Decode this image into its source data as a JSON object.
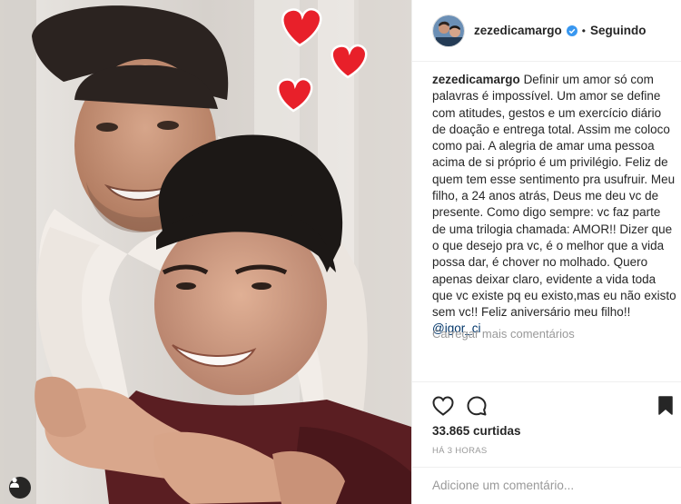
{
  "post": {
    "username": "zezedicamargo",
    "follow_label": "Seguindo",
    "separator": "•",
    "caption": "Definir um amor só com palavras é impossível. Um amor se define com atitudes, gestos e um exercício diário de doação e entrega total. Assim me coloco como pai. A alegria de amar uma pessoa acima de si próprio é um privilégio. Feliz de quem tem esse sentimento pra usufruir. Meu filho, a 24 anos atrás, Deus me deu vc de presente. Como digo sempre: vc faz parte de uma trilogia chamada: AMOR!! Dizer que o que desejo pra vc, é o melhor que a vida possa dar, é chover no molhado. Quero apenas deixar claro, evidente a vida toda que vc existe pq eu existo,mas eu não existo sem vc!! Feliz aniversário meu filho!!",
    "mention": "@igor_ci",
    "load_more": "Carregar mais comentários",
    "likes": "33.865 curtidas",
    "time": "HÁ 3 HORAS",
    "comment_placeholder": "Adicione um comentário..."
  },
  "icons": {
    "verified": "verified-badge-icon",
    "like": "heart-icon",
    "comment": "comment-bubble-icon",
    "save": "bookmark-icon",
    "tag": "user-tag-icon",
    "stickers": "heart-sticker"
  },
  "colors": {
    "verified": "#3897f0",
    "link": "#003569",
    "muted": "#999999",
    "heart_sticker": "#e8202a",
    "text": "#262626"
  }
}
